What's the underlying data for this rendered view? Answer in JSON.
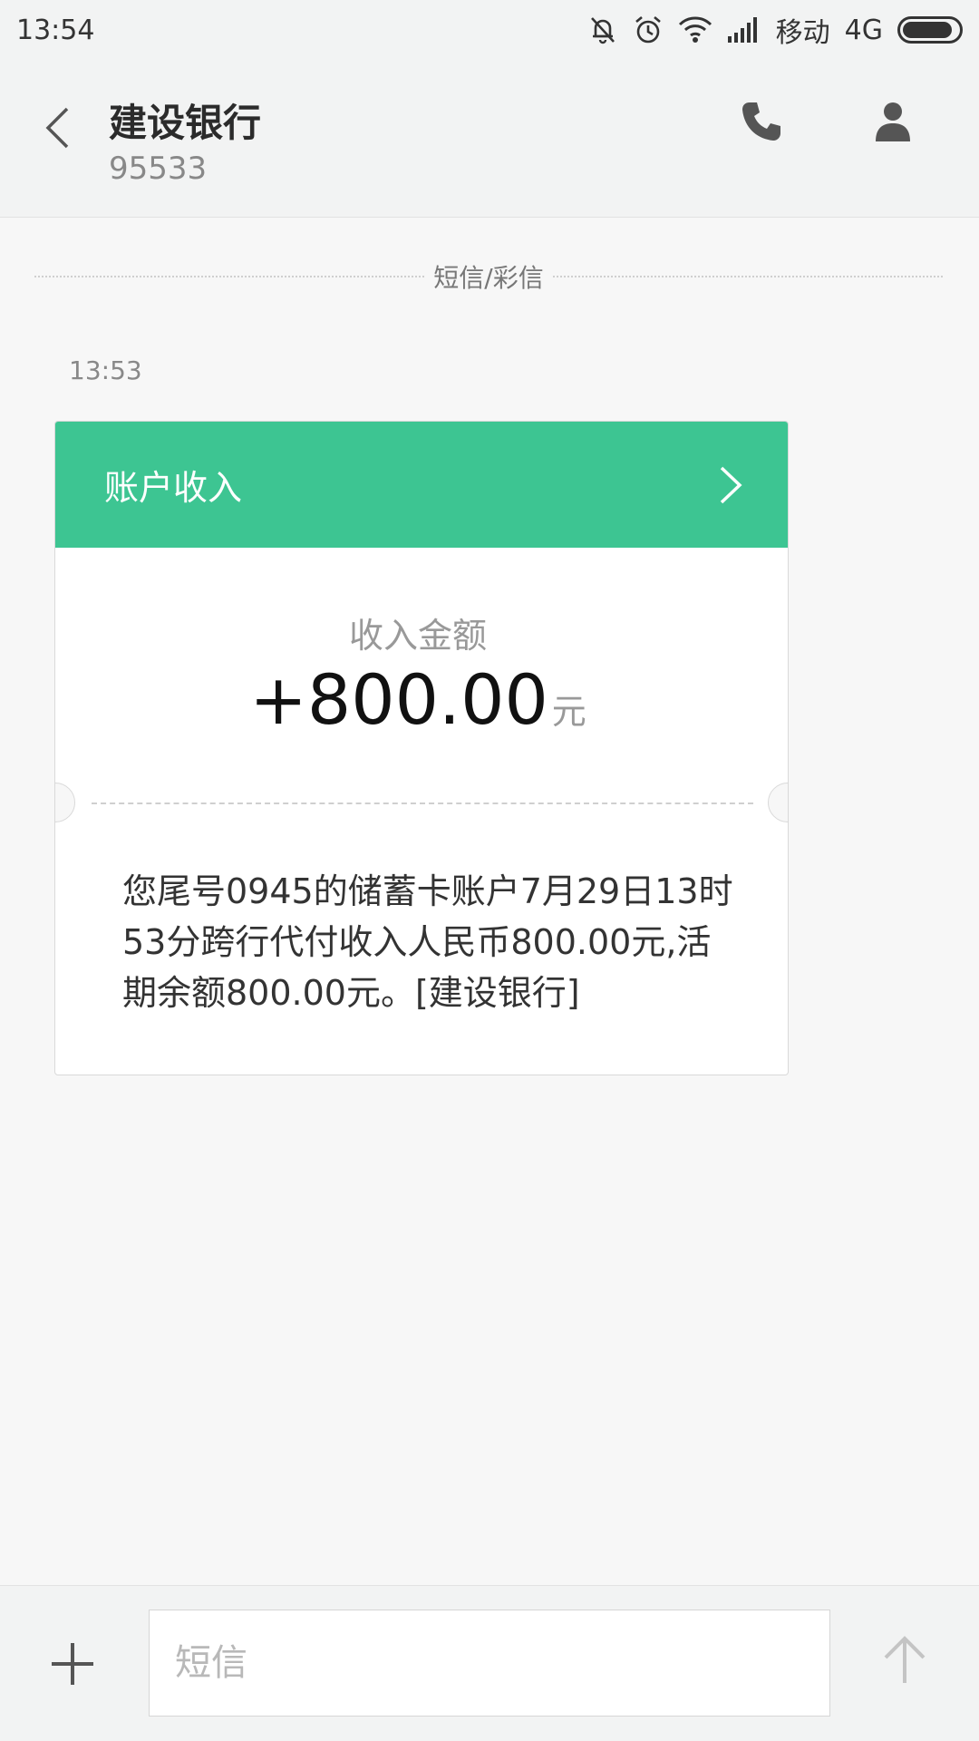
{
  "status_bar": {
    "time": "13:54",
    "carrier": "移动",
    "network": "4G",
    "icons": [
      "mute-bell-icon",
      "alarm-icon",
      "wifi-icon",
      "signal-icon",
      "battery-icon"
    ],
    "battery_level": 0.9
  },
  "header": {
    "contact_name": "建设银行",
    "contact_number": "95533",
    "icons": [
      "back-chevron-icon",
      "phone-icon",
      "person-icon"
    ]
  },
  "conversation": {
    "divider_label": "短信/彩信",
    "message_time": "13:53",
    "card": {
      "title": "账户收入",
      "amount_label": "收入金额",
      "amount": "+800.00",
      "unit": "元",
      "body": "您尾号0945的储蓄卡账户7月29日13时53分跨行代付收入人民币800.00元,活期余额800.00元。[建设银行]",
      "accent_color": "#3dc592"
    }
  },
  "input_bar": {
    "placeholder": "短信",
    "value": "",
    "icons": [
      "plus-icon",
      "send-arrow-icon"
    ]
  }
}
